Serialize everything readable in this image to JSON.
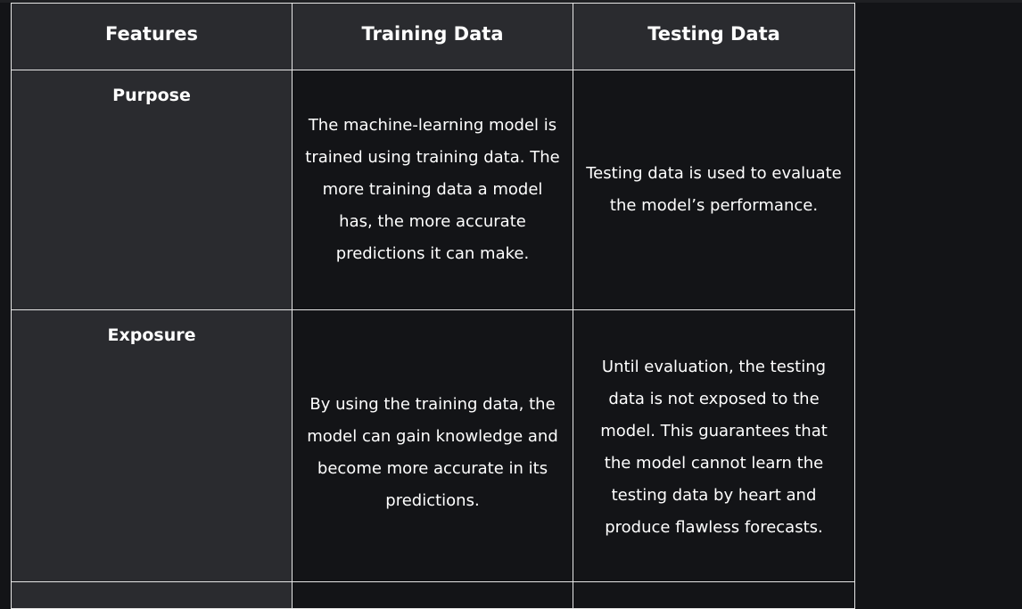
{
  "table": {
    "headers": [
      "Features",
      "Training Data",
      "Testing Data"
    ],
    "rows": [
      {
        "feature": "Purpose",
        "training": "The machine-learning model is trained using training data. The more training data a model has, the more accurate predictions it can make.",
        "testing": "Testing data is used to evaluate the model’s performance."
      },
      {
        "feature": "Exposure",
        "training": "By using the training data, the model can gain knowledge and become more accurate in its predictions.",
        "testing": "Until evaluation, the testing data is not exposed to the model. This guarantees that the model cannot learn the testing data by heart and produce flawless forecasts."
      }
    ]
  }
}
